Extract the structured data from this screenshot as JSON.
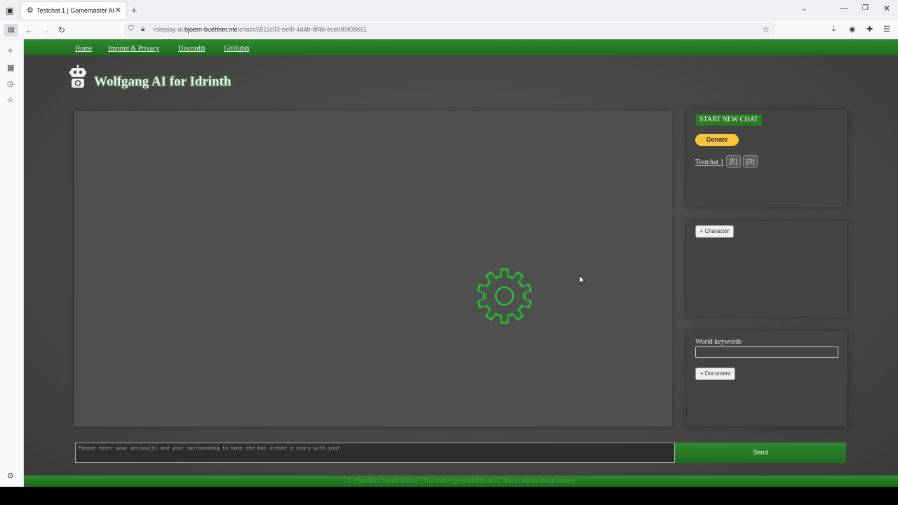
{
  "browser": {
    "tab_title": "Testchat 1 | Gamemaster AI",
    "url_prefix": "roleplay-ai.",
    "url_domain": "bjoern-buettner.me",
    "url_path": "/chat/c5811c93-bef0-4d4b-8f4b-eceb99f08d61",
    "icons": {
      "tab_list": "tab-list-icon",
      "favicon": "gear-icon",
      "tab_close": "close-icon",
      "new_tab": "plus-icon",
      "back": "arrow-left-icon",
      "forward": "arrow-right-icon",
      "reload": "reload-icon",
      "bookmark": "star-icon",
      "download": "download-icon",
      "account": "account-icon",
      "extensions": "puzzle-icon",
      "menu": "hamburger-icon"
    }
  },
  "nav": {
    "home": "Home",
    "imprint": "Imprint & Privacy",
    "discord": "Discord",
    "github": "GitHub"
  },
  "header": {
    "title": "Wolfgang AI for Idrinth"
  },
  "sidebar": {
    "new_chat": "START NEW CHAT",
    "donate": "Donate",
    "chats": [
      {
        "name": "Testchat 1",
        "edit": "[E]",
        "delete": "[D]"
      }
    ],
    "character_button": "+ Character",
    "world_keywords_label": "World keywords",
    "world_keywords_value": "",
    "document_button": "+ Document"
  },
  "composer": {
    "placeholder": "Please enter your action(s) and your surrounding to have the bot create a story with you!",
    "send": "Send"
  },
  "footer": {
    "text": "© 2024 Björn 'Idrinth' Büttner · The chat is generated by an AI, always double check content"
  },
  "colors": {
    "accent_green": "#2e8b2e",
    "gear_green": "#27c43a",
    "donate_yellow": "#fcc439"
  }
}
